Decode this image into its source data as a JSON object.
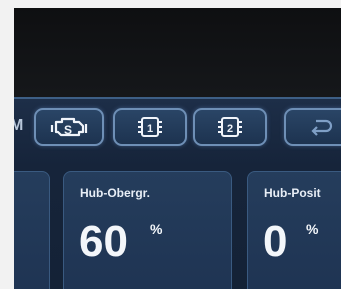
{
  "toolbar": {
    "mode_label": "M",
    "buttons": [
      {
        "icon": "engine-s-icon",
        "glyph": "S"
      },
      {
        "icon": "chip-1-icon",
        "glyph": "1"
      },
      {
        "icon": "chip-2-icon",
        "glyph": "2"
      },
      {
        "icon": "back-arrow-icon"
      }
    ]
  },
  "cards": [
    {
      "title": "",
      "value": "",
      "unit": ""
    },
    {
      "title": "Hub-Obergr.",
      "value": "60",
      "unit": "%"
    },
    {
      "title": "Hub-Posit",
      "value": "0",
      "unit": "%"
    }
  ],
  "colors": {
    "screen_bg": "#1d2e48",
    "accent_border": "#6e8fb6",
    "text": "#f3f6fa"
  }
}
